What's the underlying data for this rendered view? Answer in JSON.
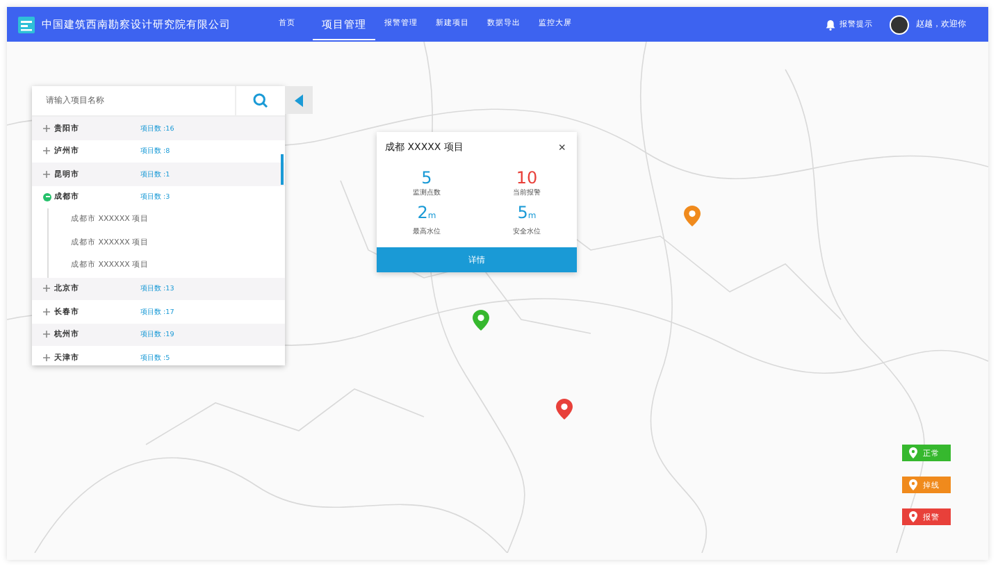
{
  "header": {
    "company": "中国建筑西南勘察设计研究院有限公司",
    "nav": [
      {
        "label": "首页",
        "selected": false
      },
      {
        "label": "项目管理",
        "selected": true
      },
      {
        "label": "报警管理",
        "selected": false
      },
      {
        "label": "新建项目",
        "selected": false
      },
      {
        "label": "数据导出",
        "selected": false
      },
      {
        "label": "监控大屏",
        "selected": false
      }
    ],
    "alert": "报警提示",
    "user": "赵越，欢迎你"
  },
  "search": {
    "placeholder": "请输入项目名称"
  },
  "cities": [
    {
      "name": "贵阳市",
      "count": "项目数 :16",
      "expanded": false
    },
    {
      "name": "泸州市",
      "count": "项目数 :8",
      "expanded": false
    },
    {
      "name": "昆明市",
      "count": "项目数 :1",
      "expanded": false
    },
    {
      "name": "成都市",
      "count": "项目数 :3",
      "expanded": true,
      "children": [
        {
          "name": "成都市 XXXXXX 项目"
        },
        {
          "name": "成都市 XXXXXX 项目"
        },
        {
          "name": "成都市 XXXXXX 项目"
        }
      ]
    },
    {
      "name": "北京市",
      "count": "项目数 :13",
      "expanded": false
    },
    {
      "name": "长春市",
      "count": "项目数 :17",
      "expanded": false
    },
    {
      "name": "杭州市",
      "count": "项目数 :19",
      "expanded": false
    },
    {
      "name": "天津市",
      "count": "项目数 :5",
      "expanded": false
    }
  ],
  "popup": {
    "title": "成都 XXXXX 项目",
    "close": "×",
    "stats": [
      {
        "value": "5",
        "label": "监测点数",
        "color": "#1a9ad6"
      },
      {
        "value": "10",
        "label": "当前报警",
        "color": "#e8403a"
      },
      {
        "value": "2",
        "unit": "m",
        "label": "最高水位",
        "color": "#1a9ad6"
      },
      {
        "value": "5",
        "unit": "m",
        "label": "安全水位",
        "color": "#1a9ad6"
      }
    ],
    "button": "详情"
  },
  "pins": [
    {
      "color": "#f08a1c"
    },
    {
      "color": "#36b82e"
    },
    {
      "color": "#e8403a"
    }
  ],
  "legend": [
    {
      "label": "正常",
      "color": "#36b82e"
    },
    {
      "label": "掉线",
      "color": "#f08a1c"
    },
    {
      "label": "报警",
      "color": "#e8403a"
    }
  ]
}
